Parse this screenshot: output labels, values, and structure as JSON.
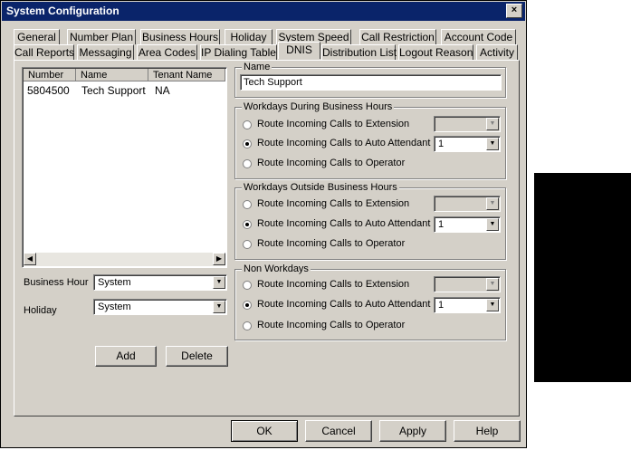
{
  "window": {
    "title": "System Configuration",
    "close_glyph": "×"
  },
  "tabs_row1": [
    "General",
    "Number Plan",
    "Business Hours",
    "Holiday",
    "System Speed",
    "Call Restriction",
    "Account Code"
  ],
  "tabs_row2": [
    "Call Reports",
    "Messaging",
    "Area Codes",
    "IP Dialing Table",
    "DNIS",
    "Distribution List",
    "Logout Reason",
    "Activity"
  ],
  "active_tab": "DNIS",
  "list": {
    "columns": [
      "Number",
      "Name",
      "Tenant Name"
    ],
    "rows": [
      {
        "number": "5804500",
        "name": "Tech Support",
        "tenant": "NA"
      }
    ]
  },
  "business_hour": {
    "label": "Business Hour",
    "value": "System"
  },
  "holiday": {
    "label": "Holiday",
    "value": "System"
  },
  "buttons": {
    "add": "Add",
    "delete": "Delete",
    "ok": "OK",
    "cancel": "Cancel",
    "apply": "Apply",
    "help": "Help"
  },
  "name_group": {
    "label": "Name",
    "value": "Tech Support"
  },
  "options": {
    "extension": "Route Incoming Calls to Extension",
    "auto_attendant": "Route Incoming Calls to Auto Attendant",
    "operator": "Route Incoming Calls to Operator"
  },
  "groups": [
    {
      "label": "Workdays During Business Hours",
      "selected": "auto_attendant",
      "attendant_value": "1"
    },
    {
      "label": "Workdays Outside Business Hours",
      "selected": "auto_attendant",
      "attendant_value": "1"
    },
    {
      "label": "Non Workdays",
      "selected": "auto_attendant",
      "attendant_value": "1"
    }
  ],
  "colors": {
    "titlebar": "#0a246a",
    "face": "#d4d0c8",
    "black_block": "#000000"
  }
}
